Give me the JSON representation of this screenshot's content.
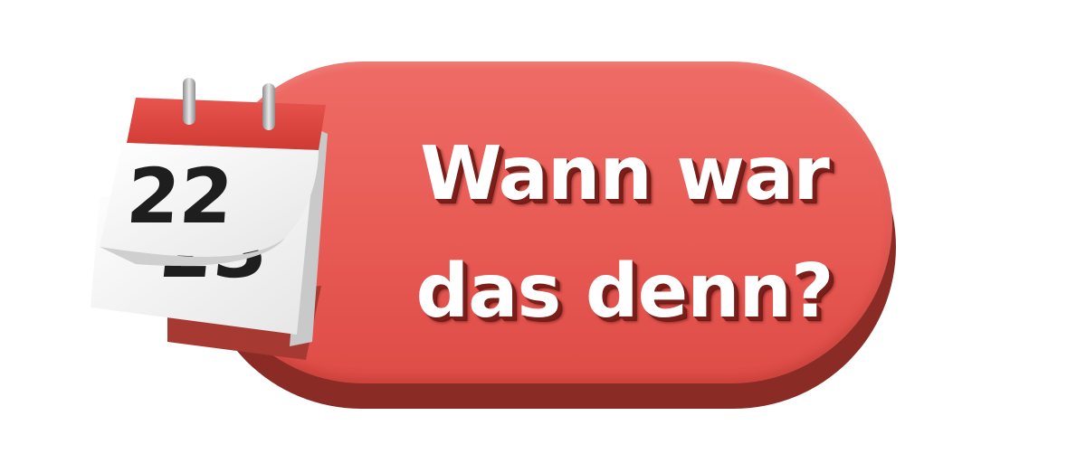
{
  "badge": {
    "line1": "Wann war",
    "line2": "das denn?",
    "colors": {
      "face": "#e85a54",
      "edge": "#8a2b25",
      "text": "#ffffff"
    }
  },
  "calendar": {
    "front_day": "22",
    "back_day": "23",
    "icon": "calendar-icon",
    "colors": {
      "header": "#e2463f",
      "rings": "#b8b8b8",
      "digits": "#1e1e1e"
    }
  }
}
